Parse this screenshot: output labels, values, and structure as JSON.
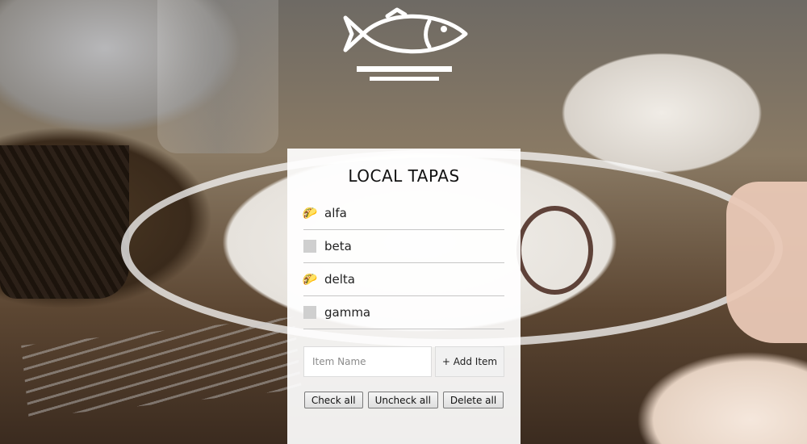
{
  "app": {
    "title": "LOCAL TAPAS",
    "logo_icon": "fish-on-plate-icon"
  },
  "items": [
    {
      "label": "alfa",
      "checked": true,
      "icon": "taco-icon"
    },
    {
      "label": "beta",
      "checked": false,
      "icon": ""
    },
    {
      "label": "delta",
      "checked": true,
      "icon": "taco-icon"
    },
    {
      "label": "gamma",
      "checked": false,
      "icon": ""
    }
  ],
  "add_form": {
    "placeholder": "Item Name",
    "value": "",
    "add_label": "+ Add Item"
  },
  "actions": {
    "check_all": "Check all",
    "uncheck_all": "Uncheck all",
    "delete_all": "Delete all"
  },
  "colors": {
    "panel_bg": "#ffffff",
    "unchecked_box": "#cfcfcf",
    "divider": "#c6c6c6"
  }
}
